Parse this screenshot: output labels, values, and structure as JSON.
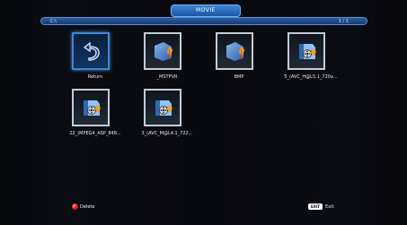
{
  "header": {
    "tab_label": "MOVIE",
    "path_left": "C:\\",
    "path_right": "1 / 1"
  },
  "files": [
    {
      "label": "Return",
      "icon": "return-icon",
      "selected": true
    },
    {
      "label": "_MSTPVR",
      "icon": "folder-icon",
      "selected": false
    },
    {
      "label": "BMP",
      "icon": "folder-icon",
      "selected": false
    },
    {
      "label": "5_(AVC_H@L5.1_720x...",
      "icon": "movie-file-icon",
      "selected": false
    },
    {
      "label": "22_(MPEG4_ASP_848...",
      "icon": "movie-file-icon",
      "selected": false
    },
    {
      "label": "3_(AVC_M@L4.1_722...",
      "icon": "movie-file-icon",
      "selected": false
    }
  ],
  "footer": {
    "delete_label": "Delete",
    "exit_key": "EXIT",
    "exit_label": "Exit"
  },
  "colors": {
    "accent": "#3d86d6",
    "delete_button": "#e81f1f"
  }
}
